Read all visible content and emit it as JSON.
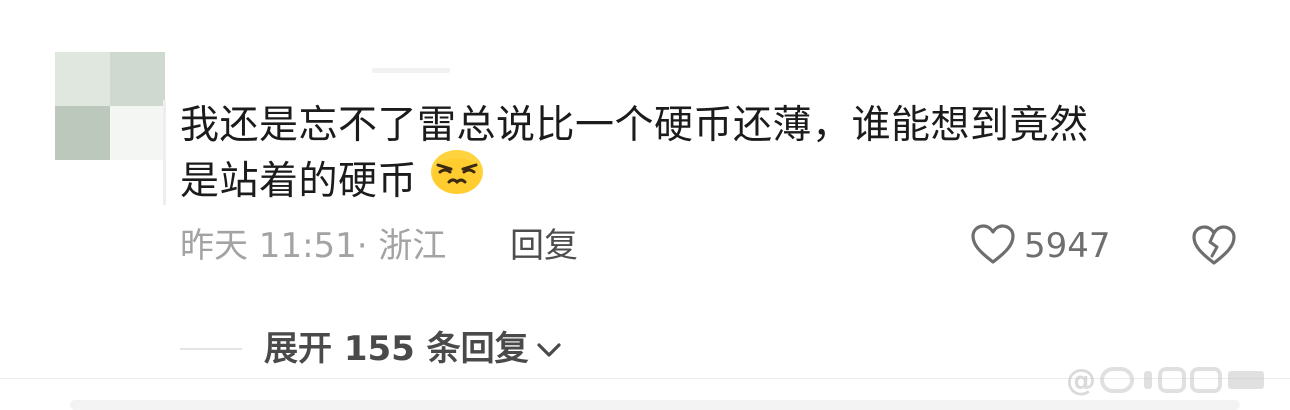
{
  "comment": {
    "text_line1": "我还是忘不了雷总说比一个硬币还薄，谁能想到竟然",
    "text_line2": "是站着的硬币",
    "emoji_icon": "smirk-face-emoji",
    "timestamp": "昨天 11:51",
    "separator": "·",
    "location": "浙江",
    "reply_label": "回复",
    "like_count": "5947"
  },
  "expand": {
    "label": "展开 155 条回复"
  },
  "watermark": {
    "text": "@"
  },
  "colors": {
    "text_primary": "#1b1b1b",
    "text_meta": "#a3a3a3",
    "emoji_yellow": "#ffd33d"
  }
}
